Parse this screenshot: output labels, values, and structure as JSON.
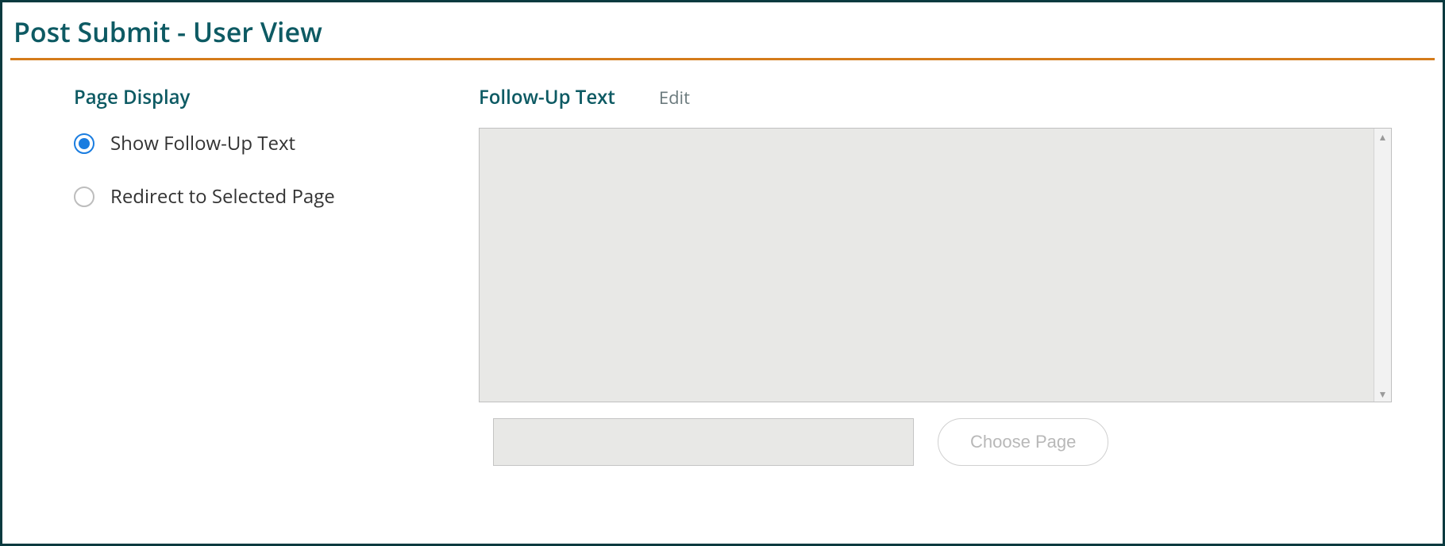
{
  "panel": {
    "title": "Post Submit - User View"
  },
  "left": {
    "section_label": "Page Display",
    "options": [
      {
        "label": "Show Follow-Up Text",
        "selected": true
      },
      {
        "label": "Redirect to Selected Page",
        "selected": false
      }
    ]
  },
  "right": {
    "followup_label": "Follow-Up Text",
    "edit_label": "Edit",
    "textarea_value": "",
    "page_input_value": "",
    "choose_page_label": "Choose Page"
  }
}
